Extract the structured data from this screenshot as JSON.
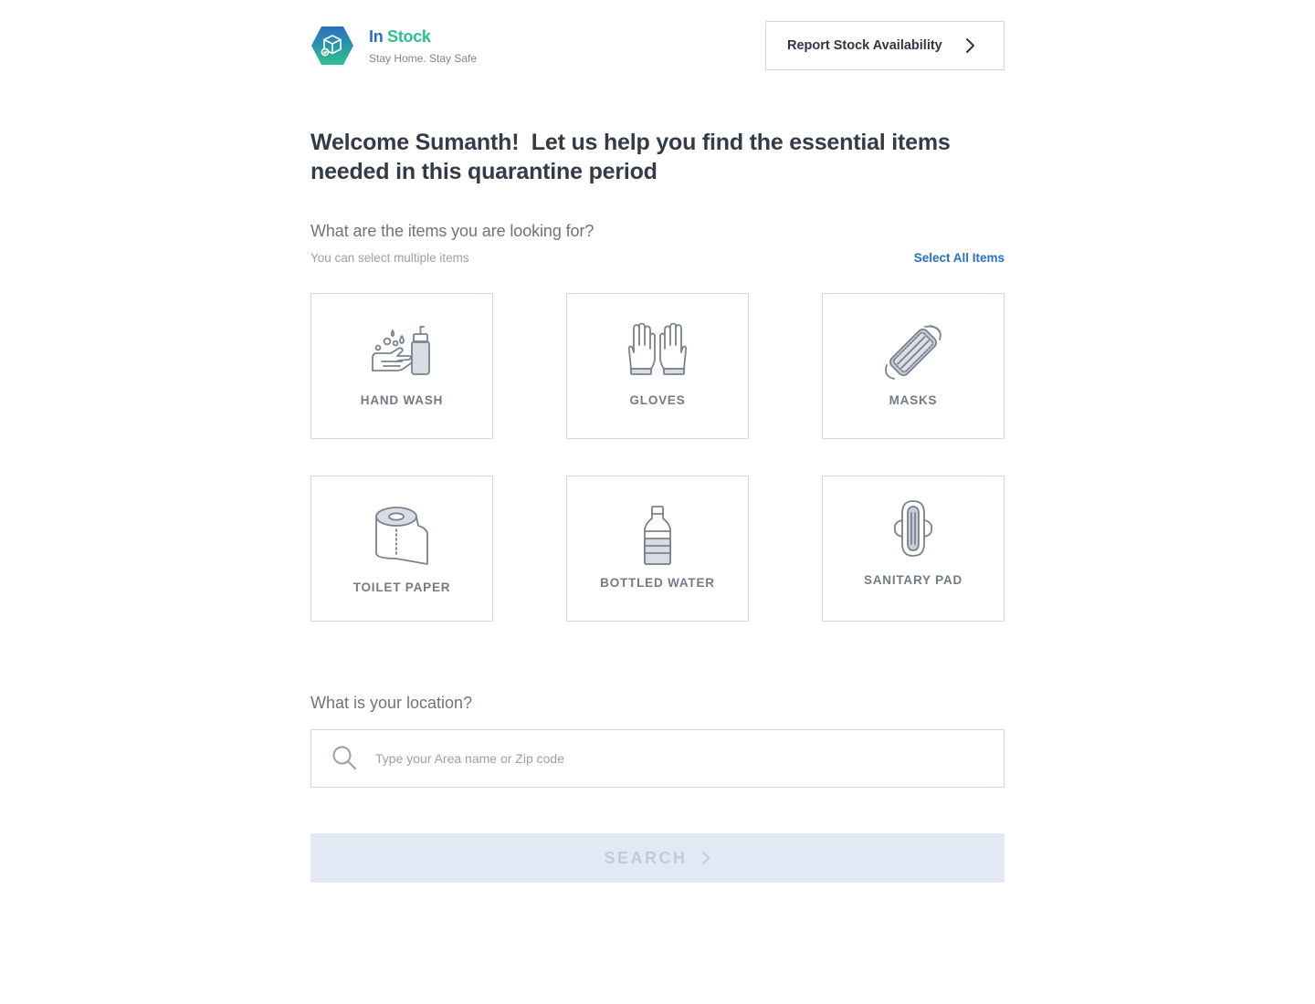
{
  "header": {
    "brand_in": "In",
    "brand_stock": "Stock",
    "tagline": "Stay Home. Stay Safe",
    "report_button": "Report Stock Availability"
  },
  "welcome": {
    "line1": "Welcome Sumanth!  Let us help you find the essential items",
    "line2": "needed in this quarantine period"
  },
  "items_section": {
    "question": "What are the items you are looking for?",
    "hint": "You can select multiple items",
    "select_all": "Select All Items",
    "items": [
      {
        "label": "HAND WASH",
        "icon": "hand-wash-icon"
      },
      {
        "label": "GLOVES",
        "icon": "gloves-icon"
      },
      {
        "label": "MASKS",
        "icon": "mask-icon"
      },
      {
        "label": "TOILET PAPER",
        "icon": "toilet-paper-icon"
      },
      {
        "label": "BOTTLED WATER",
        "icon": "water-bottle-icon"
      },
      {
        "label": "SANITARY PAD",
        "icon": "sanitary-pad-icon"
      }
    ]
  },
  "location_section": {
    "question": "What is your location?",
    "placeholder": "Type your Area name or Zip code",
    "value": ""
  },
  "search_button": "SEARCH",
  "colors": {
    "brand_blue": "#2a6fc0",
    "brand_green": "#2ebf8f",
    "border": "#d2d6dd",
    "icon_gray": "#7a828e",
    "disabled_button_bg": "#e3e9f4"
  }
}
